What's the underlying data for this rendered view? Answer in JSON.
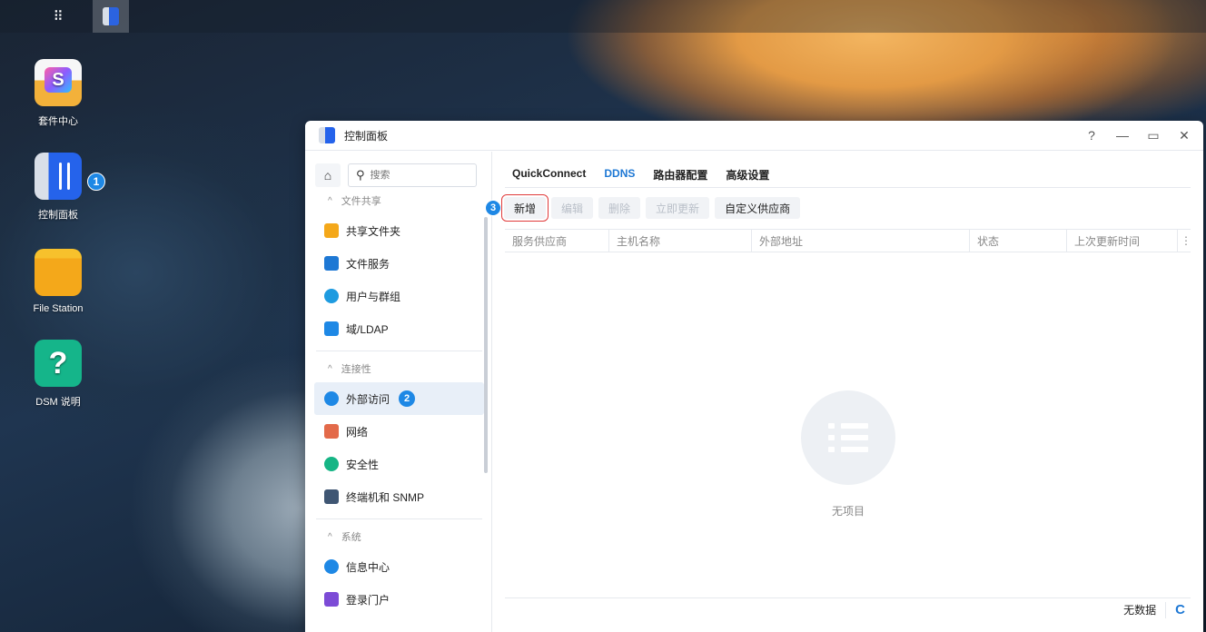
{
  "desktop": {
    "icons": [
      {
        "label": "套件中心",
        "icon": "package-center-icon"
      },
      {
        "label": "控制面板",
        "icon": "control-panel-icon",
        "badge": "1"
      },
      {
        "label": "File Station",
        "icon": "folder-icon"
      },
      {
        "label": "DSM 说明",
        "icon": "help-icon",
        "glyph": "?"
      }
    ]
  },
  "taskbar": {
    "grid_glyph": "⠿"
  },
  "window": {
    "title": "控制面板",
    "controls": {
      "help": "?",
      "minimize": "—",
      "maximize": "▭",
      "close": "✕"
    }
  },
  "sidebar": {
    "search_placeholder": "搜索",
    "sections": [
      {
        "title": "文件共享",
        "items": [
          {
            "label": "共享文件夹",
            "icon": "shared-folder-icon",
            "color": "#f4a81a"
          },
          {
            "label": "文件服务",
            "icon": "file-services-icon",
            "color": "#1e78d4"
          },
          {
            "label": "用户与群组",
            "icon": "users-icon",
            "color": "#1e9be0"
          },
          {
            "label": "域/LDAP",
            "icon": "ldap-icon",
            "color": "#1e88e5"
          }
        ]
      },
      {
        "title": "连接性",
        "items": [
          {
            "label": "外部访问",
            "icon": "external-access-icon",
            "color": "#1e88e5",
            "badge": "2",
            "active": true
          },
          {
            "label": "网络",
            "icon": "network-icon",
            "color": "#e36a4a"
          },
          {
            "label": "安全性",
            "icon": "security-icon",
            "color": "#16b585"
          },
          {
            "label": "终端机和 SNMP",
            "icon": "terminal-icon",
            "color": "#3f5673"
          }
        ]
      },
      {
        "title": "系统",
        "items": [
          {
            "label": "信息中心",
            "icon": "info-center-icon",
            "color": "#1e88e5"
          },
          {
            "label": "登录门户",
            "icon": "login-portal-icon",
            "color": "#7c4bd6"
          }
        ]
      }
    ]
  },
  "tabs": [
    "QuickConnect",
    "DDNS",
    "路由器配置",
    "高级设置"
  ],
  "active_tab": "DDNS",
  "toolbar": {
    "badge": "3",
    "add": "新增",
    "edit": "编辑",
    "delete": "删除",
    "update_now": "立即更新",
    "custom_provider": "自定义供应商"
  },
  "table": {
    "columns": [
      "服务供应商",
      "主机名称",
      "外部地址",
      "状态",
      "上次更新时间"
    ],
    "more": "⋮"
  },
  "empty_text": "无项目",
  "footer": {
    "no_data": "无数据",
    "refresh": "C"
  },
  "colors": {
    "accent": "#1e78d4",
    "badge": "#1e88e5",
    "highlight_border": "#e03a3a"
  }
}
